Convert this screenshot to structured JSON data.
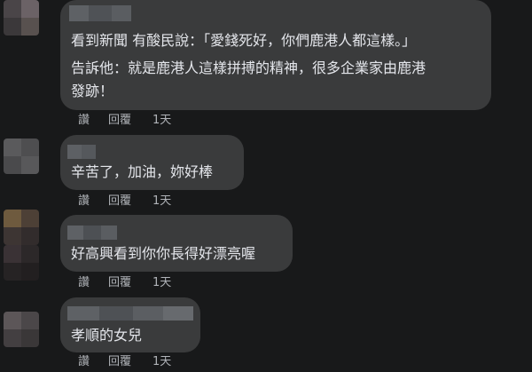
{
  "comments": [
    {
      "lines": [
        "看到新聞 有酸民說：「愛錢死好，你們鹿港人都這樣。」",
        "告訴他：就是鹿港人這樣拼搏的精神，很多企業家由鹿港",
        "發跡！"
      ],
      "actions": {
        "like": "讚",
        "reply": "回覆",
        "time": "1天"
      }
    },
    {
      "lines": [
        "辛苦了，加油，妳好棒"
      ],
      "actions": {
        "like": "讚",
        "reply": "回覆",
        "time": "1天"
      }
    },
    {
      "lines": [
        "好高興看到你你長得好漂亮喔"
      ],
      "actions": {
        "like": "讚",
        "reply": "回覆",
        "time": "1天"
      }
    },
    {
      "lines": [
        "孝順的女兒"
      ],
      "actions": {
        "like": "讚",
        "reply": "回覆",
        "time": "1天"
      }
    }
  ],
  "colors": {
    "background": "#18191a",
    "bubble": "#3a3b3c",
    "text": "#e4e6eb",
    "secondary": "#b0b3b8"
  }
}
